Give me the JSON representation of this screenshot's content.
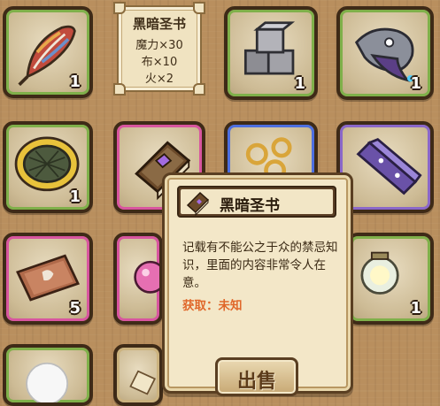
{
  "recipe": {
    "title": "黑暗圣书",
    "lines": [
      "魔力×30",
      "布×10",
      "火×2"
    ]
  },
  "slots": [
    {
      "name": "feather",
      "rim": "green",
      "count": "1"
    },
    {
      "name": "stone-blocks",
      "rim": "green",
      "count": "1"
    },
    {
      "name": "ghost-fish",
      "rim": "green",
      "count": "1"
    },
    {
      "name": "woven-nest",
      "rim": "green",
      "count": "1"
    },
    {
      "name": "dark-bible",
      "rim": "pink",
      "count": ""
    },
    {
      "name": "gold-rings",
      "rim": "blue",
      "count": ""
    },
    {
      "name": "purple-crystal-bar",
      "rim": "blue",
      "count": ""
    },
    {
      "name": "leather-scroll",
      "rim": "pink",
      "count": "5"
    },
    {
      "name": "pink-orb",
      "rim": "pink",
      "count": ""
    },
    {
      "name": "lantern",
      "rim": "green",
      "count": "1"
    },
    {
      "name": "white-puff",
      "rim": "green",
      "count": ""
    },
    {
      "name": "bottom-item",
      "rim": "beige",
      "count": ""
    }
  ],
  "tooltip": {
    "title": "黑暗圣书",
    "description": "记载有不能公之于众的禁忌知识，里面的内容非常令人在意。",
    "source": "获取：未知"
  },
  "sell_button": {
    "label": "出售"
  },
  "colors": {
    "background": "#b98f5e",
    "source_text": "#e0672a",
    "rim_green": "#7fb04a",
    "rim_pink": "#d8559f",
    "rim_blue": "#4d6fe0"
  }
}
